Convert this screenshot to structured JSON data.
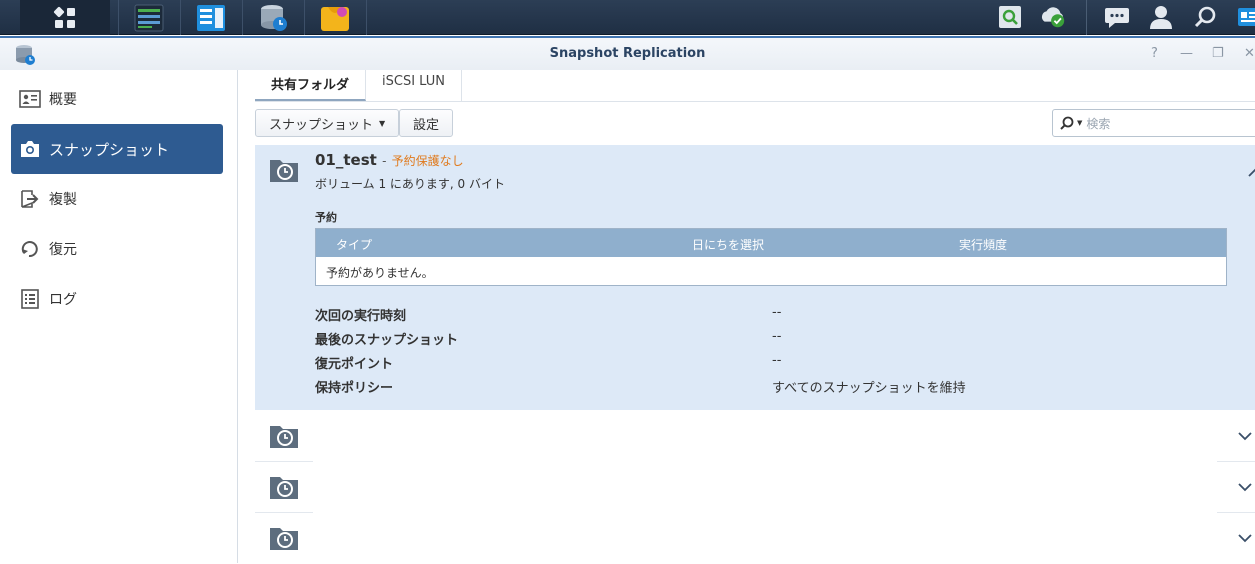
{
  "window": {
    "title": "Snapshot Replication",
    "controls": {
      "help": "?",
      "minimize": "—",
      "restore": "❐",
      "close": "✕"
    }
  },
  "sidebar": {
    "items": [
      {
        "label": "概要",
        "icon": "overview-icon",
        "active": false
      },
      {
        "label": "スナップショット",
        "icon": "camera-icon",
        "active": true
      },
      {
        "label": "複製",
        "icon": "replication-icon",
        "active": false
      },
      {
        "label": "復元",
        "icon": "restore-icon",
        "active": false
      },
      {
        "label": "ログ",
        "icon": "log-icon",
        "active": false
      }
    ]
  },
  "tabs": [
    {
      "label": "共有フォルダ",
      "active": true
    },
    {
      "label": "iSCSI LUN",
      "active": false
    }
  ],
  "toolbar": {
    "snapshot_label": "スナップショット",
    "settings_label": "設定",
    "search_placeholder": "検索"
  },
  "expanded_folder": {
    "name": "01_test",
    "separator": "-",
    "status": "予約保護なし",
    "volume_info": "ボリューム 1 にあります, 0 バイト",
    "schedule_label": "予約",
    "schedule_columns": [
      "タイプ",
      "日にちを選択",
      "実行頻度"
    ],
    "schedule_empty": "予約がありません。",
    "details": [
      {
        "label": "次回の実行時刻",
        "value": "--"
      },
      {
        "label": "最後のスナップショット",
        "value": "--"
      },
      {
        "label": "復元ポイント",
        "value": "--"
      },
      {
        "label": "保持ポリシー",
        "value": "すべてのスナップショットを維持"
      }
    ]
  },
  "collapsed_rows": 3,
  "colors": {
    "accent": "#2e5b91",
    "status_orange": "#e07a1d",
    "panel_bg": "#dde9f7",
    "table_header": "#8fafcd"
  }
}
